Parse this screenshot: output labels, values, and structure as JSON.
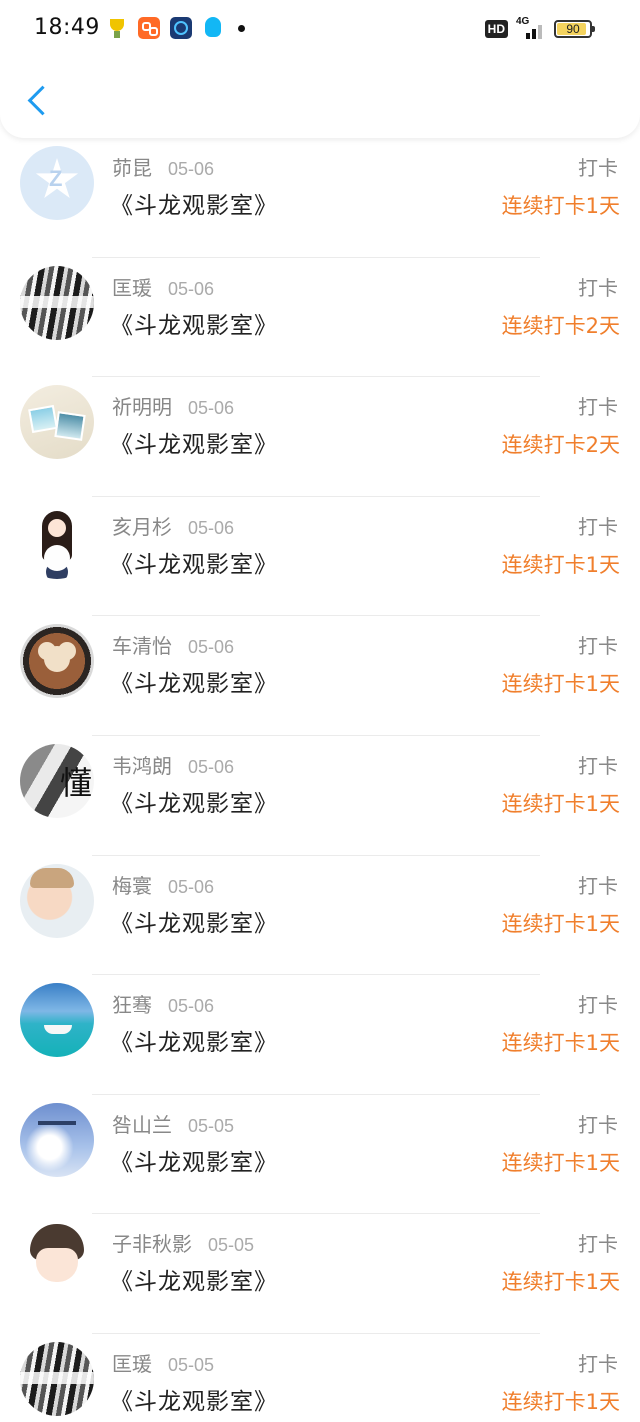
{
  "status_bar": {
    "time": "18:49",
    "network": "4G",
    "hd": "HD",
    "battery": 90,
    "notification_icons": [
      "trophy-icon",
      "orange-app-icon",
      "blue-app-icon",
      "qq-icon",
      "dot-icon"
    ]
  },
  "header": {
    "back_icon": "chevron-left-icon",
    "accent_color": "#1e9bf0"
  },
  "colors": {
    "streak": "#f07f2d",
    "meta": "#888888"
  },
  "records": [
    {
      "name": "茆昆",
      "date": "05-06",
      "group": "《斗龙观影室》",
      "checkin": "打卡",
      "streak": "连续打卡1天",
      "avatar": "av-qq"
    },
    {
      "name": "匡瑗",
      "date": "05-06",
      "group": "《斗龙观影室》",
      "checkin": "打卡",
      "streak": "连续打卡2天",
      "avatar": "av-bw"
    },
    {
      "name": "祈明明",
      "date": "05-06",
      "group": "《斗龙观影室》",
      "checkin": "打卡",
      "streak": "连续打卡2天",
      "avatar": "av-photos"
    },
    {
      "name": "亥月杉",
      "date": "05-06",
      "group": "《斗龙观影室》",
      "checkin": "打卡",
      "streak": "连续打卡1天",
      "avatar": "av-girl"
    },
    {
      "name": "车清怡",
      "date": "05-06",
      "group": "《斗龙观影室》",
      "checkin": "打卡",
      "streak": "连续打卡1天",
      "avatar": "av-coffee"
    },
    {
      "name": "韦鸿朗",
      "date": "05-06",
      "group": "《斗龙观影室》",
      "checkin": "打卡",
      "streak": "连续打卡1天",
      "avatar": "av-dong"
    },
    {
      "name": "梅寰",
      "date": "05-06",
      "group": "《斗龙观影室》",
      "checkin": "打卡",
      "streak": "连续打卡1天",
      "avatar": "av-face"
    },
    {
      "name": "狂骞",
      "date": "05-06",
      "group": "《斗龙观影室》",
      "checkin": "打卡",
      "streak": "连续打卡1天",
      "avatar": "av-sea"
    },
    {
      "name": "咎山兰",
      "date": "05-05",
      "group": "《斗龙观影室》",
      "checkin": "打卡",
      "streak": "连续打卡1天",
      "avatar": "av-sky"
    },
    {
      "name": "子非秋影",
      "date": "05-05",
      "group": "《斗龙观影室》",
      "checkin": "打卡",
      "streak": "连续打卡1天",
      "avatar": "av-boy"
    },
    {
      "name": "匡瑗",
      "date": "05-05",
      "group": "《斗龙观影室》",
      "checkin": "打卡",
      "streak": "连续打卡1天",
      "avatar": "av-bw"
    }
  ]
}
